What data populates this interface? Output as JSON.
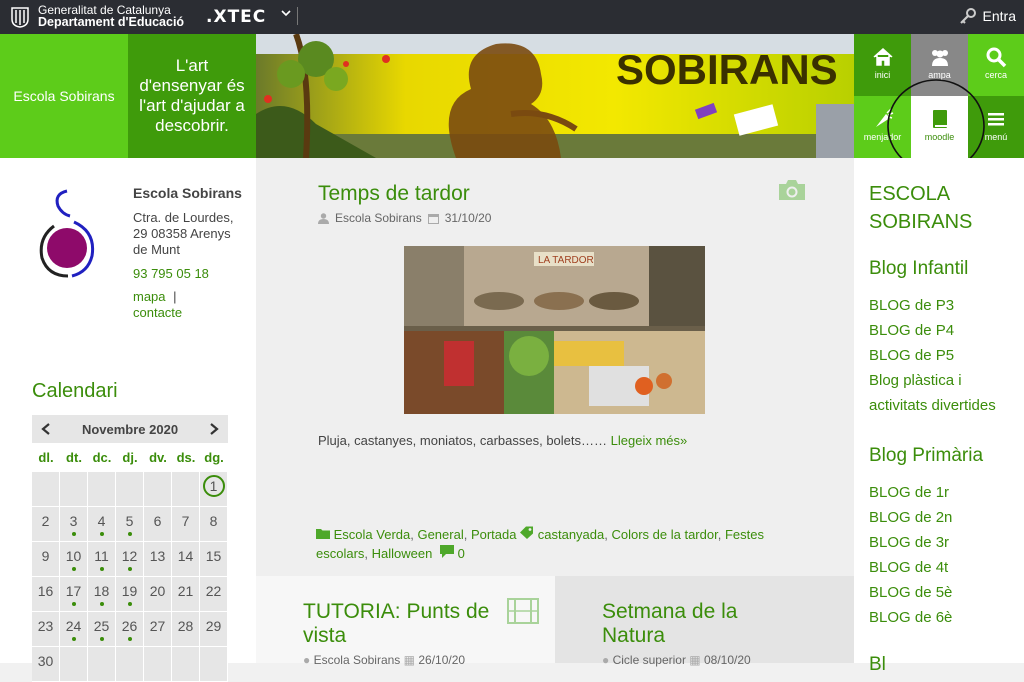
{
  "topbar": {
    "gencat_line1": "Generalitat de Catalunya",
    "gencat_line2": "Departament d'Educació",
    "xtec": ".XTEC",
    "login": "Entra"
  },
  "header": {
    "school_name": "Escola Sobirans",
    "motto": "L'art d'ensenyar és l'art d'ajudar a descobrir.",
    "banner_text": "SOBIRANS"
  },
  "iconbar": {
    "inici": "inici",
    "ampa": "ampa",
    "cerca": "cerca",
    "menjador": "menjador",
    "moodle": "moodle",
    "menu": "menú"
  },
  "school": {
    "name": "Escola Sobirans",
    "address": "Ctra. de Lourdes, 29 08358 Arenys de Munt",
    "phone": "93 795 05 18",
    "map": "mapa",
    "separator": "|",
    "contact": "contacte"
  },
  "calendar": {
    "title": "Calendari",
    "month": "Novembre",
    "year": "2020",
    "day_names": [
      "dl.",
      "dt.",
      "dc.",
      "dj.",
      "dv.",
      "ds.",
      "dg."
    ],
    "today": "1",
    "days": [
      "",
      "",
      "",
      "",
      "",
      "",
      "1",
      "2",
      "3",
      "4",
      "5",
      "6",
      "7",
      "8",
      "9",
      "10",
      "11",
      "12",
      "13",
      "14",
      "15",
      "16",
      "17",
      "18",
      "19",
      "20",
      "21",
      "22",
      "23",
      "24",
      "25",
      "26",
      "27",
      "28",
      "29",
      "30",
      "",
      "",
      "",
      "",
      "",
      ""
    ],
    "event_days": [
      "3",
      "4",
      "5",
      "10",
      "11",
      "12",
      "17",
      "18",
      "19",
      "24",
      "25",
      "26"
    ]
  },
  "post1": {
    "title": "Temps de tardor",
    "author": "Escola Sobirans",
    "date": "31/10/20",
    "image_text": "LA TARDOR",
    "excerpt": "Pluja, castanyes, moniatos, carbasses, bolets……",
    "read_more": "Llegeix més»",
    "categories": [
      "Escola Verda",
      "General",
      "Portada"
    ],
    "tags": [
      "castanyada",
      "Colors de la tardor",
      "Festes escolars",
      "Halloween"
    ],
    "comments": "0"
  },
  "post2": {
    "title": "TUTORIA: Punts de vista",
    "author": "Escola Sobirans",
    "date": "26/10/20"
  },
  "post3": {
    "title": "Setmana de la Natura",
    "author": "Cicle superior",
    "date": "08/10/20"
  },
  "sidebar_right": {
    "title": "ESCOLA SOBIRANS",
    "infantil_heading": "Blog Infantil",
    "infantil_links": [
      "BLOG de P3",
      "BLOG de P4",
      "BLOG de P5",
      "Blog plàstica i activitats divertides"
    ],
    "primaria_heading": "Blog Primària",
    "primaria_links": [
      "BLOG de 1r",
      "BLOG de 2n",
      "BLOG de 3r",
      "BLOG de 4t",
      "BLOG de 5è",
      "BLOG de 6è"
    ],
    "next_heading": "Bl"
  },
  "colors": {
    "green_light": "#5dcc1a",
    "green_dark": "#3f9b0b",
    "link_green": "#3b8d0b",
    "topbar": "#2b2d33",
    "ampa_grey": "#888888"
  }
}
